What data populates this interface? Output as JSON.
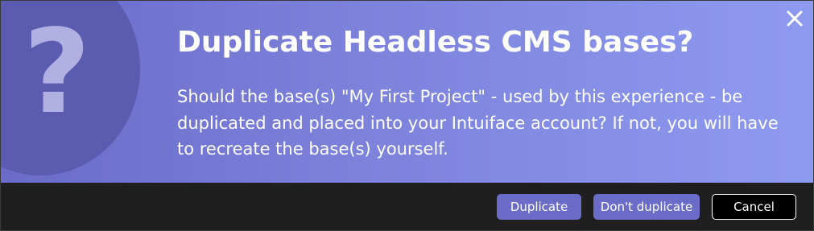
{
  "dialog": {
    "title": "Duplicate Headless CMS bases?",
    "message": "Should the base(s) \"My First Project\" - used by this experience - be duplicated and placed into your Intuiface account? If not, you will have to recreate the base(s) yourself.",
    "icon": "question-mark-icon",
    "close_icon": "close-icon"
  },
  "buttons": {
    "duplicate_label": "Duplicate",
    "dont_duplicate_label": "Don't duplicate",
    "cancel_label": "Cancel"
  },
  "colors": {
    "banner_start": "#6a6cc8",
    "banner_end": "#8e9af0",
    "icon_circle": "#5b5bb0",
    "icon_glyph": "#b0b0e3",
    "footer_background": "#1f1f1f",
    "primary_button": "#6a6cc8",
    "cancel_button": "#000000"
  }
}
